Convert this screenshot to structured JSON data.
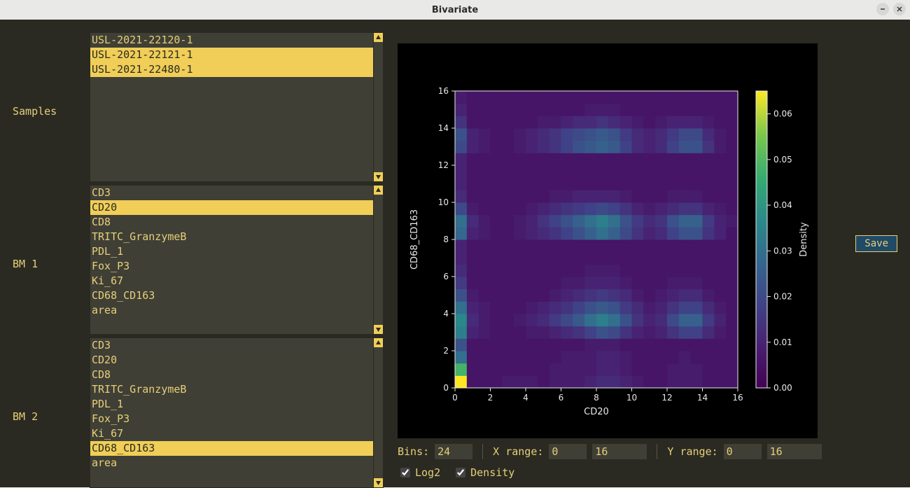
{
  "window": {
    "title": "Bivariate"
  },
  "labels": {
    "samples": "Samples",
    "bm1": "BM 1",
    "bm2": "BM 2"
  },
  "lists": {
    "samples": {
      "items": [
        "USL-2021-22120-1",
        "USL-2021-22121-1",
        "USL-2021-22480-1"
      ],
      "selected": [
        1,
        2
      ]
    },
    "bm1": {
      "items": [
        "CD3",
        "CD20",
        "CD8",
        "TRITC_GranzymeB",
        "PDL_1",
        "Fox_P3",
        "Ki_67",
        "CD68_CD163",
        "area"
      ],
      "selected": [
        1
      ]
    },
    "bm2": {
      "items": [
        "CD3",
        "CD20",
        "CD8",
        "TRITC_GranzymeB",
        "PDL_1",
        "Fox_P3",
        "Ki_67",
        "CD68_CD163",
        "area"
      ],
      "selected": [
        7
      ]
    }
  },
  "controls": {
    "bins_label": "Bins:",
    "bins_value": "24",
    "xrange_label": "X range:",
    "xmin": "0",
    "xmax": "16",
    "yrange_label": "Y range:",
    "ymin": "0",
    "ymax": "16",
    "log2_label": "Log2",
    "log2_checked": true,
    "density_label": "Density",
    "density_checked": true
  },
  "save_label": "Save",
  "chart_data": {
    "type": "heatmap",
    "xlabel": "CD20",
    "ylabel": "CD68_CD163",
    "colorbar_label": "Density",
    "x_range": [
      0,
      16
    ],
    "y_range": [
      0,
      16
    ],
    "x_ticks": [
      0,
      2,
      4,
      6,
      8,
      10,
      12,
      14,
      16
    ],
    "y_ticks": [
      0,
      2,
      4,
      6,
      8,
      10,
      12,
      14,
      16
    ],
    "color_ticks": [
      0.0,
      0.01,
      0.02,
      0.03,
      0.04,
      0.05,
      0.06
    ],
    "color_range": [
      0.0,
      0.065
    ],
    "bins": 24,
    "grid": [
      [
        0.065,
        0.006,
        0.006,
        0.006,
        0.008,
        0.008,
        0.008,
        0.006,
        0.008,
        0.008,
        0.008,
        0.01,
        0.012,
        0.012,
        0.01,
        0.008,
        0.006,
        0.006,
        0.008,
        0.008,
        0.008,
        0.006,
        0.006,
        0.006
      ],
      [
        0.048,
        0.006,
        0.006,
        0.006,
        0.006,
        0.006,
        0.006,
        0.006,
        0.008,
        0.008,
        0.008,
        0.008,
        0.01,
        0.01,
        0.008,
        0.006,
        0.006,
        0.006,
        0.008,
        0.008,
        0.008,
        0.006,
        0.006,
        0.006
      ],
      [
        0.03,
        0.006,
        0.006,
        0.006,
        0.006,
        0.006,
        0.006,
        0.006,
        0.006,
        0.008,
        0.008,
        0.008,
        0.01,
        0.01,
        0.008,
        0.006,
        0.006,
        0.006,
        0.006,
        0.008,
        0.006,
        0.006,
        0.006,
        0.006
      ],
      [
        0.022,
        0.006,
        0.006,
        0.006,
        0.006,
        0.006,
        0.006,
        0.006,
        0.006,
        0.006,
        0.006,
        0.008,
        0.008,
        0.008,
        0.006,
        0.006,
        0.006,
        0.006,
        0.006,
        0.006,
        0.006,
        0.006,
        0.006,
        0.006
      ],
      [
        0.034,
        0.01,
        0.008,
        0.006,
        0.006,
        0.006,
        0.008,
        0.008,
        0.01,
        0.012,
        0.014,
        0.018,
        0.022,
        0.02,
        0.014,
        0.01,
        0.008,
        0.01,
        0.014,
        0.018,
        0.018,
        0.012,
        0.008,
        0.006
      ],
      [
        0.036,
        0.012,
        0.008,
        0.006,
        0.006,
        0.008,
        0.01,
        0.012,
        0.016,
        0.02,
        0.024,
        0.03,
        0.034,
        0.03,
        0.022,
        0.014,
        0.01,
        0.012,
        0.02,
        0.026,
        0.026,
        0.016,
        0.01,
        0.006
      ],
      [
        0.03,
        0.01,
        0.008,
        0.006,
        0.006,
        0.006,
        0.008,
        0.01,
        0.012,
        0.014,
        0.018,
        0.022,
        0.024,
        0.022,
        0.016,
        0.012,
        0.008,
        0.01,
        0.014,
        0.018,
        0.018,
        0.012,
        0.008,
        0.006
      ],
      [
        0.022,
        0.008,
        0.006,
        0.006,
        0.006,
        0.006,
        0.006,
        0.006,
        0.008,
        0.01,
        0.012,
        0.014,
        0.016,
        0.014,
        0.012,
        0.008,
        0.006,
        0.008,
        0.01,
        0.012,
        0.012,
        0.008,
        0.006,
        0.006
      ],
      [
        0.016,
        0.006,
        0.006,
        0.006,
        0.006,
        0.006,
        0.006,
        0.006,
        0.006,
        0.008,
        0.008,
        0.01,
        0.01,
        0.01,
        0.008,
        0.006,
        0.006,
        0.006,
        0.008,
        0.008,
        0.008,
        0.006,
        0.006,
        0.006
      ],
      [
        0.012,
        0.006,
        0.006,
        0.006,
        0.006,
        0.006,
        0.006,
        0.006,
        0.006,
        0.006,
        0.006,
        0.008,
        0.008,
        0.008,
        0.006,
        0.006,
        0.006,
        0.006,
        0.006,
        0.006,
        0.006,
        0.006,
        0.006,
        0.006
      ],
      [
        0.01,
        0.006,
        0.006,
        0.006,
        0.006,
        0.006,
        0.006,
        0.006,
        0.006,
        0.006,
        0.006,
        0.006,
        0.006,
        0.006,
        0.006,
        0.006,
        0.006,
        0.006,
        0.006,
        0.006,
        0.006,
        0.006,
        0.006,
        0.006
      ],
      [
        0.01,
        0.006,
        0.006,
        0.006,
        0.006,
        0.006,
        0.006,
        0.006,
        0.006,
        0.006,
        0.006,
        0.006,
        0.006,
        0.006,
        0.006,
        0.006,
        0.006,
        0.006,
        0.006,
        0.006,
        0.006,
        0.006,
        0.006,
        0.006
      ],
      [
        0.028,
        0.01,
        0.008,
        0.006,
        0.006,
        0.008,
        0.01,
        0.012,
        0.014,
        0.018,
        0.022,
        0.026,
        0.03,
        0.026,
        0.02,
        0.014,
        0.01,
        0.012,
        0.018,
        0.022,
        0.022,
        0.014,
        0.01,
        0.006
      ],
      [
        0.03,
        0.012,
        0.008,
        0.006,
        0.006,
        0.008,
        0.01,
        0.014,
        0.018,
        0.022,
        0.026,
        0.03,
        0.034,
        0.03,
        0.022,
        0.016,
        0.012,
        0.014,
        0.022,
        0.026,
        0.026,
        0.016,
        0.01,
        0.008
      ],
      [
        0.02,
        0.008,
        0.006,
        0.006,
        0.006,
        0.006,
        0.008,
        0.01,
        0.012,
        0.014,
        0.016,
        0.018,
        0.02,
        0.018,
        0.014,
        0.01,
        0.008,
        0.01,
        0.012,
        0.014,
        0.014,
        0.01,
        0.008,
        0.006
      ],
      [
        0.012,
        0.006,
        0.006,
        0.006,
        0.006,
        0.006,
        0.006,
        0.006,
        0.008,
        0.008,
        0.01,
        0.01,
        0.01,
        0.01,
        0.008,
        0.006,
        0.006,
        0.006,
        0.008,
        0.008,
        0.008,
        0.006,
        0.006,
        0.006
      ],
      [
        0.01,
        0.006,
        0.006,
        0.006,
        0.006,
        0.006,
        0.006,
        0.006,
        0.006,
        0.006,
        0.006,
        0.006,
        0.006,
        0.006,
        0.006,
        0.006,
        0.006,
        0.006,
        0.006,
        0.006,
        0.006,
        0.006,
        0.006,
        0.006
      ],
      [
        0.01,
        0.006,
        0.006,
        0.006,
        0.006,
        0.006,
        0.006,
        0.006,
        0.006,
        0.006,
        0.006,
        0.006,
        0.006,
        0.006,
        0.006,
        0.006,
        0.006,
        0.006,
        0.006,
        0.006,
        0.006,
        0.006,
        0.006,
        0.006
      ],
      [
        0.01,
        0.006,
        0.006,
        0.006,
        0.006,
        0.006,
        0.006,
        0.006,
        0.006,
        0.006,
        0.006,
        0.006,
        0.006,
        0.006,
        0.006,
        0.006,
        0.006,
        0.006,
        0.006,
        0.006,
        0.006,
        0.006,
        0.006,
        0.006
      ],
      [
        0.02,
        0.01,
        0.008,
        0.006,
        0.006,
        0.008,
        0.01,
        0.012,
        0.014,
        0.018,
        0.022,
        0.024,
        0.026,
        0.024,
        0.018,
        0.012,
        0.01,
        0.012,
        0.018,
        0.022,
        0.022,
        0.014,
        0.008,
        0.006
      ],
      [
        0.022,
        0.01,
        0.008,
        0.006,
        0.006,
        0.008,
        0.01,
        0.012,
        0.014,
        0.018,
        0.02,
        0.022,
        0.024,
        0.022,
        0.016,
        0.012,
        0.01,
        0.012,
        0.016,
        0.02,
        0.02,
        0.012,
        0.008,
        0.006
      ],
      [
        0.014,
        0.006,
        0.006,
        0.006,
        0.006,
        0.006,
        0.006,
        0.008,
        0.008,
        0.01,
        0.012,
        0.012,
        0.014,
        0.012,
        0.01,
        0.008,
        0.006,
        0.008,
        0.01,
        0.01,
        0.01,
        0.008,
        0.006,
        0.006
      ],
      [
        0.01,
        0.006,
        0.006,
        0.006,
        0.006,
        0.006,
        0.006,
        0.006,
        0.006,
        0.006,
        0.006,
        0.008,
        0.008,
        0.008,
        0.006,
        0.006,
        0.006,
        0.006,
        0.006,
        0.006,
        0.006,
        0.006,
        0.006,
        0.006
      ],
      [
        0.008,
        0.006,
        0.006,
        0.006,
        0.006,
        0.006,
        0.006,
        0.006,
        0.006,
        0.006,
        0.006,
        0.006,
        0.006,
        0.006,
        0.006,
        0.006,
        0.006,
        0.006,
        0.006,
        0.006,
        0.006,
        0.006,
        0.006,
        0.006
      ]
    ]
  }
}
